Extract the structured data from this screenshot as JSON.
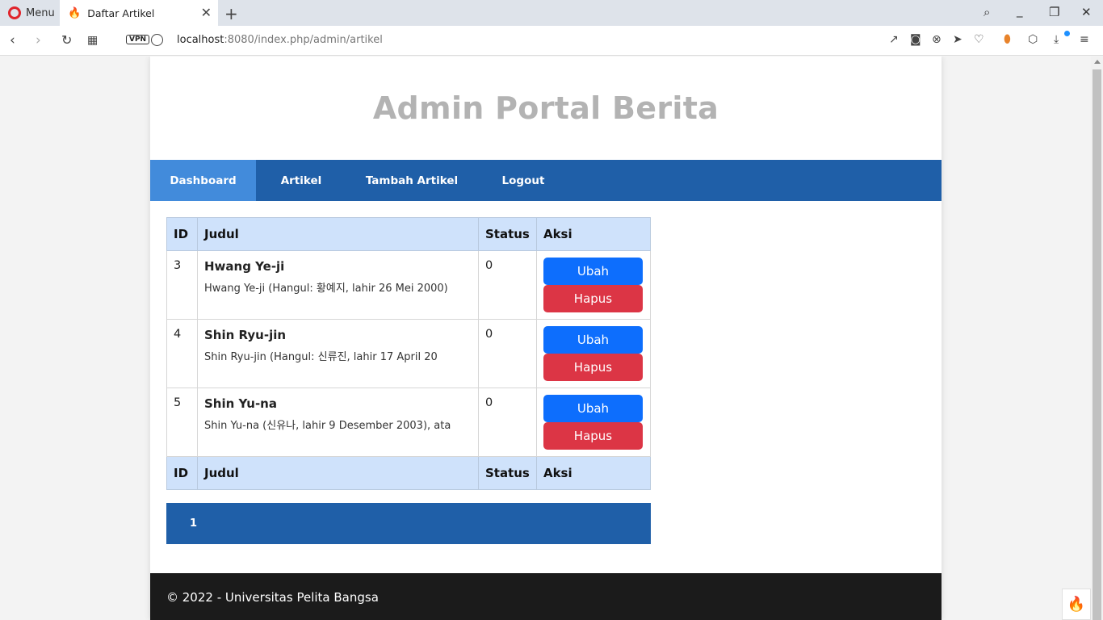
{
  "browser": {
    "menu_label": "Menu",
    "tab_title": "Daftar Artikel",
    "url_host": "localhost",
    "url_path": ":8080/index.php/admin/artikel",
    "vpn_label": "VPN"
  },
  "site": {
    "title": "Admin Portal Berita",
    "nav": [
      {
        "label": "Dashboard"
      },
      {
        "label": "Artikel"
      },
      {
        "label": "Tambah Artikel"
      },
      {
        "label": "Logout"
      }
    ]
  },
  "table": {
    "headers": {
      "id": "ID",
      "judul": "Judul",
      "status": "Status",
      "aksi": "Aksi"
    },
    "rows": [
      {
        "id": "3",
        "title": "Hwang Ye-ji",
        "excerpt": "Hwang Ye-ji (Hangul: 황예지, lahir 26 Mei 2000)",
        "status": "0",
        "edit": "Ubah",
        "delete": "Hapus"
      },
      {
        "id": "4",
        "title": "Shin Ryu-jin",
        "excerpt": "Shin Ryu-jin (Hangul: 신류진, lahir 17 April 20",
        "status": "0",
        "edit": "Ubah",
        "delete": "Hapus"
      },
      {
        "id": "5",
        "title": "Shin Yu-na",
        "excerpt": "Shin Yu-na (신유나, lahir 9 Desember 2003), ata",
        "status": "0",
        "edit": "Ubah",
        "delete": "Hapus"
      }
    ]
  },
  "pagination": {
    "current": "1"
  },
  "footer": {
    "text": "© 2022 - Universitas Pelita Bangsa"
  },
  "colors": {
    "nav_bg": "#1f5fa8",
    "nav_active": "#428bdb",
    "edit_btn": "#0d6efd",
    "delete_btn": "#dc3545",
    "table_head": "#cfe2fb",
    "footer_bg": "#1b1b1b"
  }
}
